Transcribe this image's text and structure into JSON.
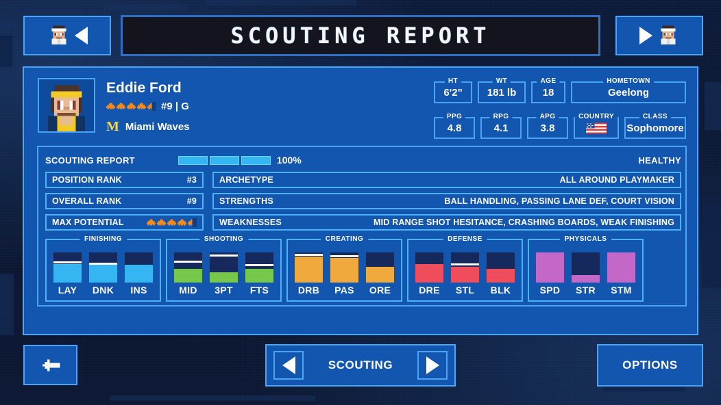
{
  "header": {
    "title": "SCOUTING REPORT",
    "prev_player_icon": "player-portrait-icon",
    "prev_arrow_icon": "triangle-left-icon",
    "next_player_icon": "player-portrait-icon",
    "next_arrow_icon": "triangle-right-icon"
  },
  "player": {
    "avatar_icon": "player-avatar-icon",
    "name": "Eddie Ford",
    "star_rating": 4.5,
    "number_and_position": "#9 | G",
    "team_logo_letter": "M",
    "team_name": "Miami Waves",
    "stats": [
      {
        "label": "HT",
        "value": "6'2\""
      },
      {
        "label": "WT",
        "value": "181 lb"
      },
      {
        "label": "AGE",
        "value": "18"
      },
      {
        "label": "HOMETOWN",
        "value": "Geelong"
      },
      {
        "label": "PPG",
        "value": "4.8"
      },
      {
        "label": "RPG",
        "value": "4.1"
      },
      {
        "label": "APG",
        "value": "3.8"
      },
      {
        "label": "COUNTRY",
        "value": "",
        "icon": "usa-flag-icon"
      },
      {
        "label": "CLASS",
        "value": "Sophomore"
      }
    ]
  },
  "scouting": {
    "section_label": "SCOUTING REPORT",
    "progress_segments": 3,
    "progress_segments_filled": 3,
    "progress_percent": "100%",
    "health_status": "HEALTHY",
    "rank_rows": [
      {
        "key": "POSITION RANK",
        "value": "#3"
      },
      {
        "key": "OVERALL RANK",
        "value": "#9"
      },
      {
        "key": "MAX POTENTIAL",
        "value": "",
        "stars": 4.5
      }
    ],
    "info_rows": [
      {
        "key": "ARCHETYPE",
        "value": "ALL AROUND PLAYMAKER"
      },
      {
        "key": "STRENGTHS",
        "value": "BALL HANDLING, PASSING LANE DEF, COURT VISION"
      },
      {
        "key": "WEAKNESSES",
        "value": "MID RANGE SHOT HESITANCE, CRASHING BOARDS, WEAK FINISHING"
      }
    ]
  },
  "attributes": {
    "groups": [
      {
        "label": "FINISHING",
        "color": "#35b6f2",
        "items": [
          {
            "code": "LAY",
            "value": 62,
            "tick": 66
          },
          {
            "code": "DNK",
            "value": 60,
            "tick": 62
          },
          {
            "code": "INS",
            "value": 58,
            "tick": 0
          }
        ]
      },
      {
        "label": "SHOOTING",
        "color": "#76c84a",
        "items": [
          {
            "code": "MID",
            "value": 45,
            "tick": 68
          },
          {
            "code": "3PT",
            "value": 34,
            "tick": 88
          },
          {
            "code": "FTS",
            "value": 45,
            "tick": 57
          }
        ]
      },
      {
        "label": "CREATING",
        "color": "#f0a93c",
        "items": [
          {
            "code": "DRB",
            "value": 86,
            "tick": 90
          },
          {
            "code": "PAS",
            "value": 82,
            "tick": 86
          },
          {
            "code": "ORE",
            "value": 52,
            "tick": 0
          }
        ]
      },
      {
        "label": "DEFENSE",
        "color": "#ef4c5c",
        "items": [
          {
            "code": "DRE",
            "value": 62,
            "tick": 0
          },
          {
            "code": "STL",
            "value": 52,
            "tick": 60
          },
          {
            "code": "BLK",
            "value": 45,
            "tick": 0
          }
        ]
      },
      {
        "label": "PHYSICALS",
        "color": "#c368c9",
        "items": [
          {
            "code": "SPD",
            "value": 100,
            "tick": 0
          },
          {
            "code": "STR",
            "value": 26,
            "tick": 0
          },
          {
            "code": "STM",
            "value": 100,
            "tick": 0
          }
        ]
      }
    ]
  },
  "footer": {
    "back_icon": "arrow-left-icon",
    "scouting_prev_icon": "triangle-left-icon",
    "scouting_label": "SCOUTING",
    "scouting_next_icon": "triangle-right-icon",
    "options_label": "OPTIONS"
  },
  "colors": {
    "panel_blue": "#1356b0",
    "border_blue": "#4aa6f5",
    "background": "#0b1733",
    "meter_empty": "#16295c",
    "accent_yellow": "#ffd93b"
  }
}
